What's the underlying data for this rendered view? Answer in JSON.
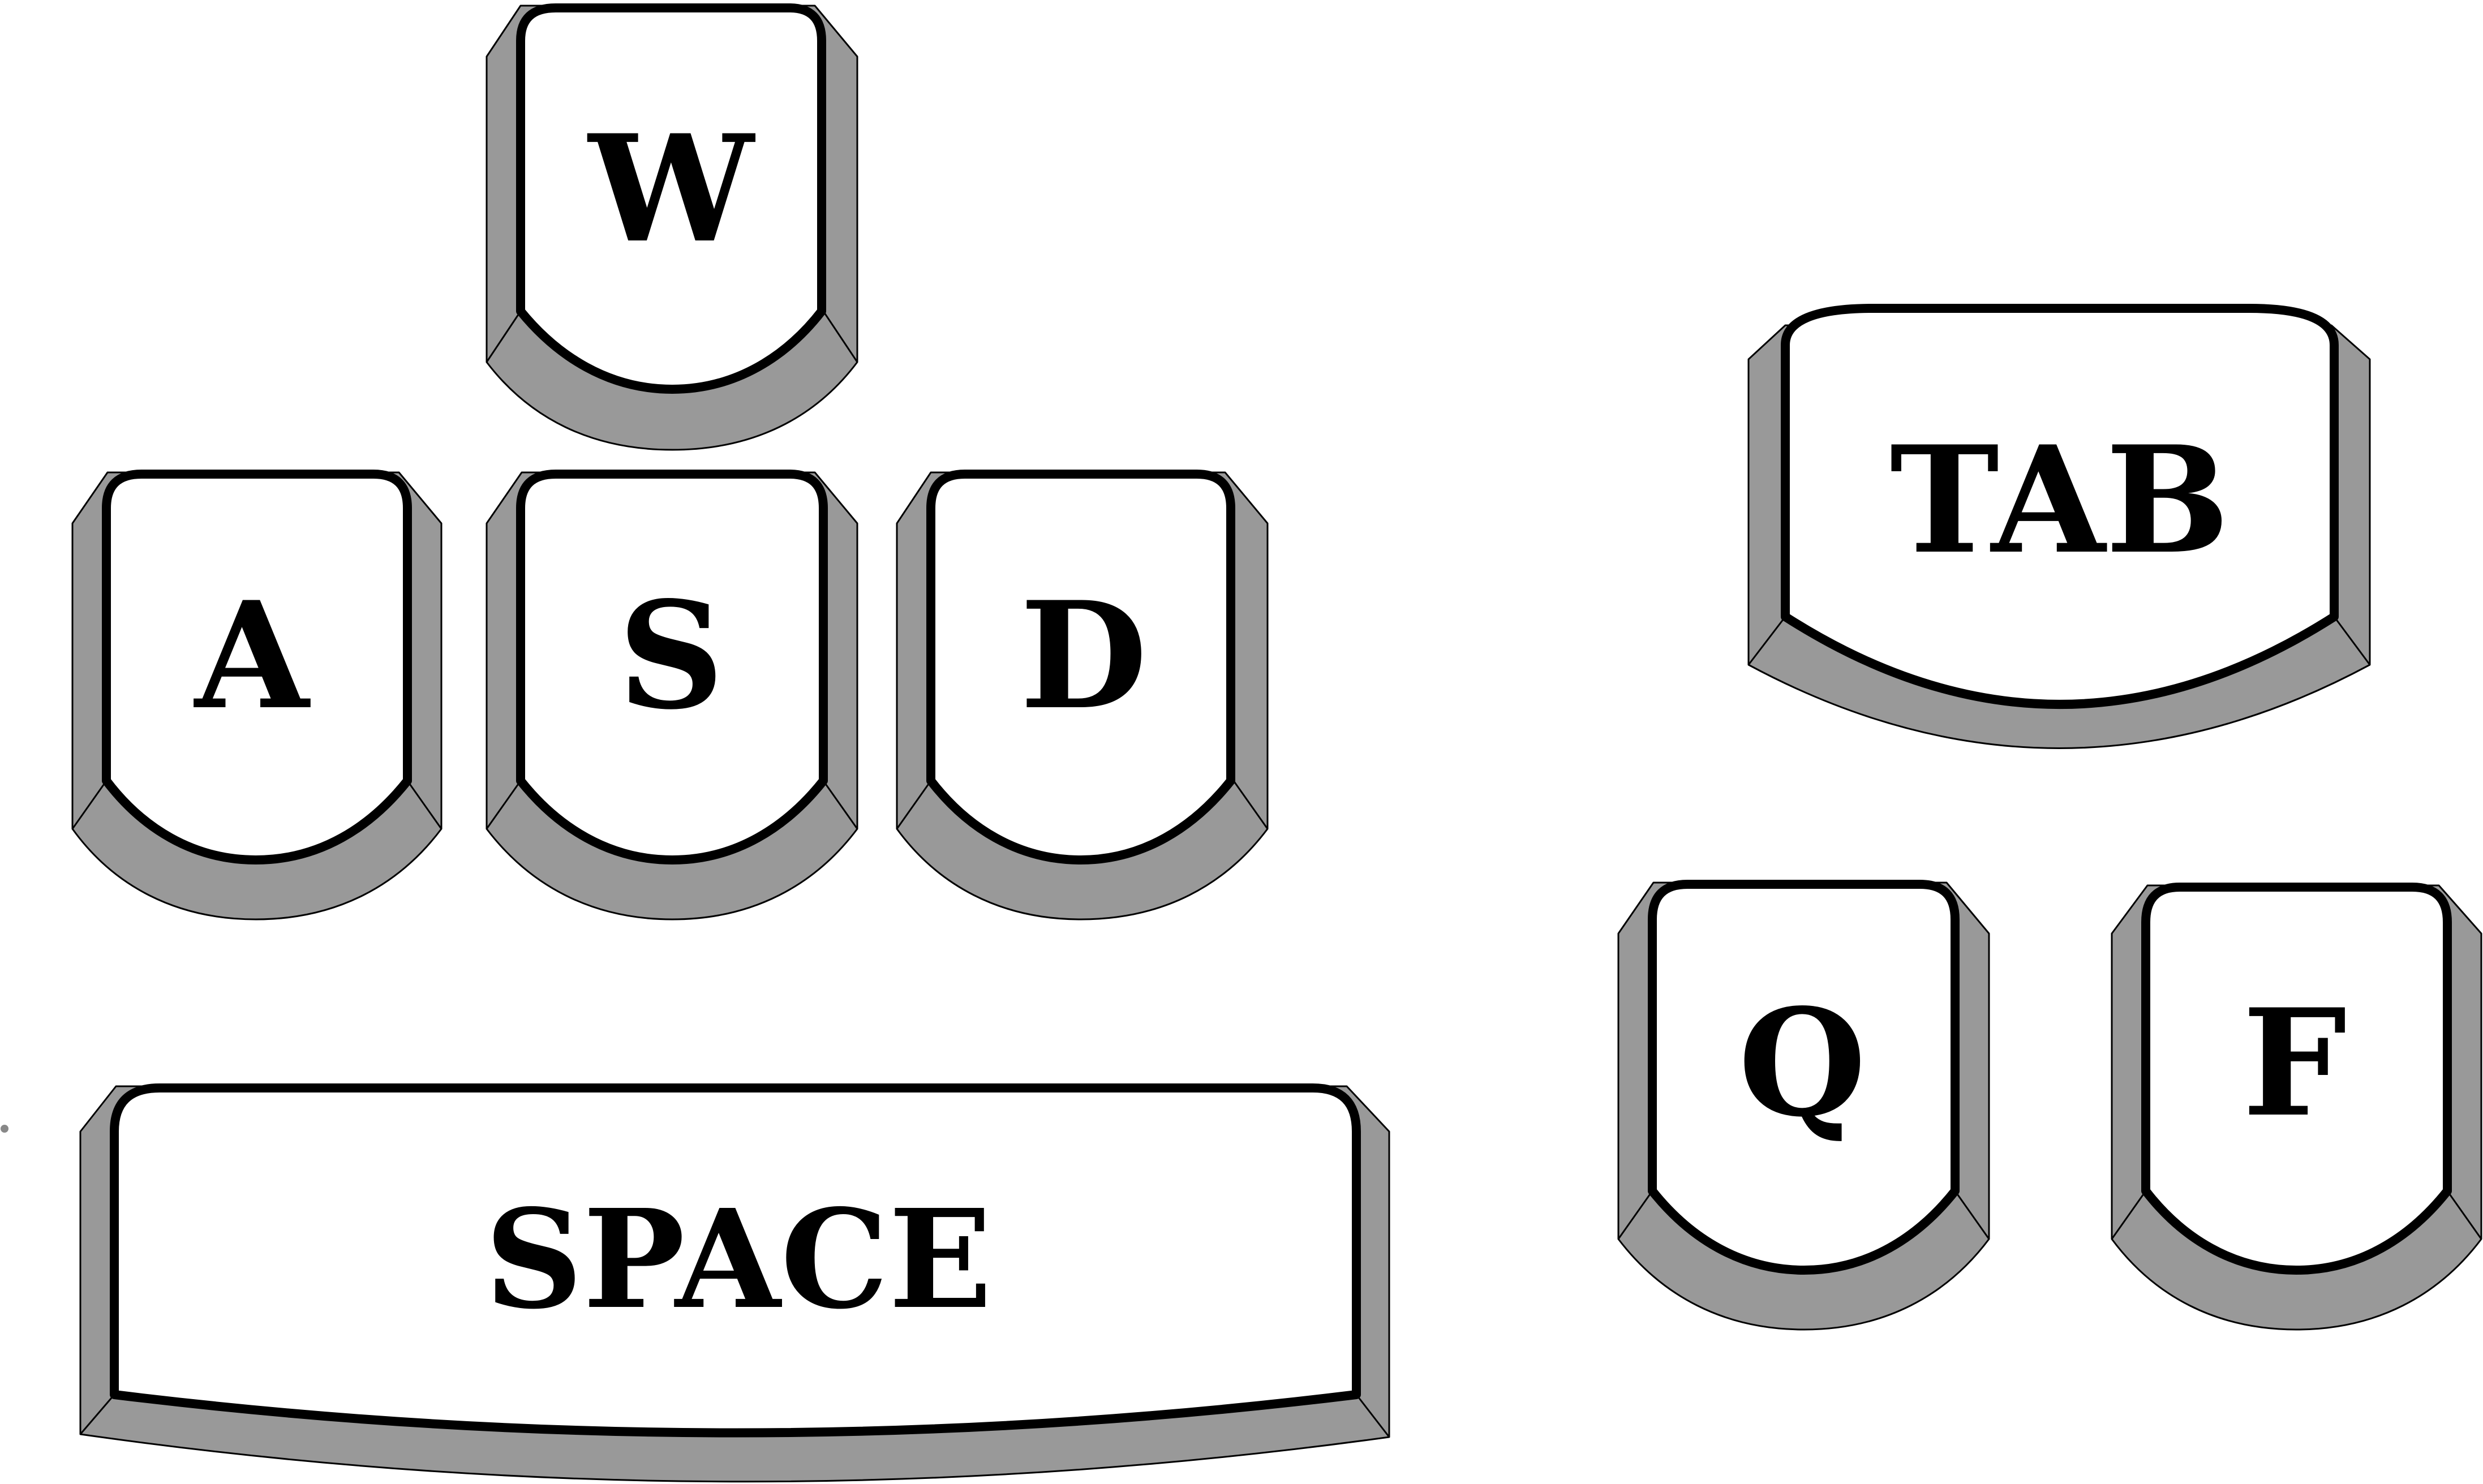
{
  "colors": {
    "background": "#ffffff",
    "key_top": "#ffffff",
    "key_side": "#999999",
    "outline": "#000000"
  },
  "keys": {
    "w": {
      "label": "W"
    },
    "a": {
      "label": "A"
    },
    "s": {
      "label": "S"
    },
    "d": {
      "label": "D"
    },
    "space": {
      "label": "SPACE"
    },
    "tab": {
      "label": "TAB"
    },
    "q": {
      "label": "Q"
    },
    "f": {
      "label": "F"
    }
  }
}
